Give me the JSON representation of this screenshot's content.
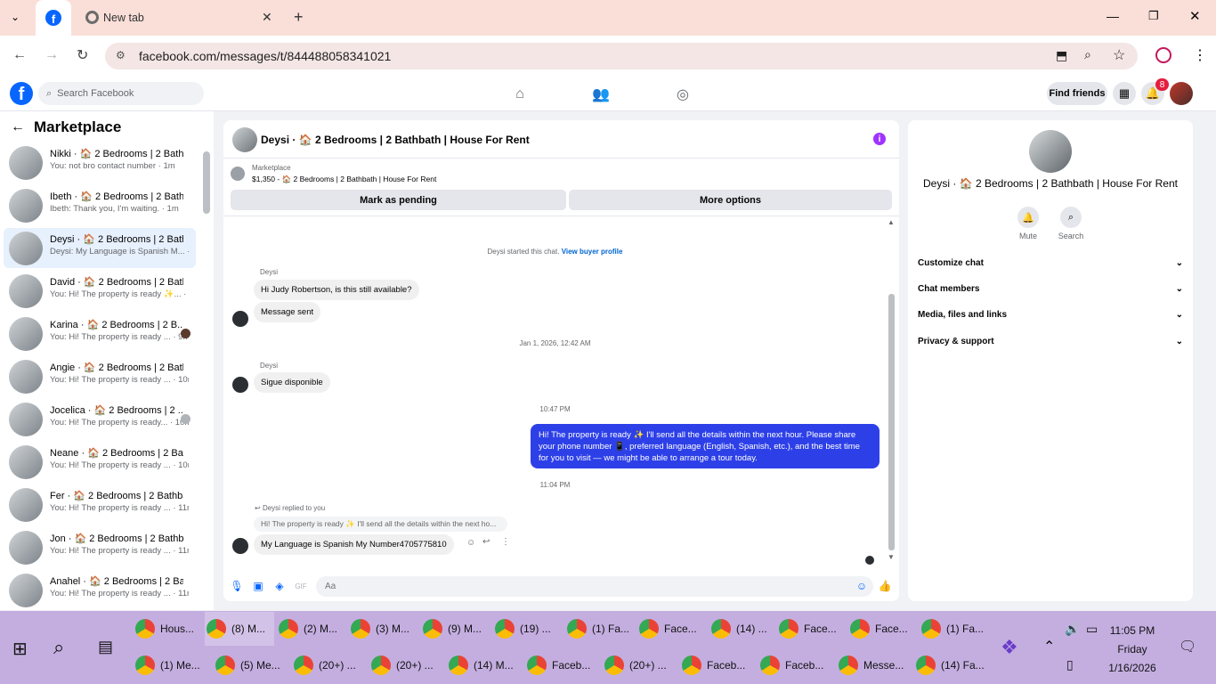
{
  "browser": {
    "tab_active_title": "Facebook",
    "tab_new_label": "New tab",
    "url": "facebook.com/messages/t/844488058341021"
  },
  "fb": {
    "search_placeholder": "Search Facebook",
    "find_friends": "Find friends",
    "notification_count": "8"
  },
  "sidebar": {
    "title": "Marketplace",
    "conversations": [
      {
        "name": "Nikki · 🏠 2 Bedrooms | 2 Bath...",
        "preview": "You: not bro contact number · 1m"
      },
      {
        "name": "Ibeth · 🏠 2 Bedrooms | 2 Bath...",
        "preview": "Ibeth: Thank you, I'm waiting. · 1m"
      },
      {
        "name": "Deysi · 🏠 2 Bedrooms | 2 Bath...",
        "preview": "Deysi: My Language is Spanish M... · 1m"
      },
      {
        "name": "David · 🏠 2 Bedrooms | 2 Bath...",
        "preview": "You: Hi! The property is ready ✨... · 9m"
      },
      {
        "name": "Karina · 🏠 2 Bedrooms | 2 B...",
        "preview": "You: Hi! The property is ready ... · 9m"
      },
      {
        "name": "Angie · 🏠 2 Bedrooms | 2 Bath...",
        "preview": "You: Hi! The property is ready ... · 10m"
      },
      {
        "name": "Jocelica · 🏠 2 Bedrooms | 2 ...",
        "preview": "You: Hi! The property is ready... · 10m"
      },
      {
        "name": "Neane · 🏠 2 Bedrooms | 2 Bat...",
        "preview": "You: Hi! The property is ready ... · 10m"
      },
      {
        "name": "Fer · 🏠 2 Bedrooms | 2 Bathba...",
        "preview": "You: Hi! The property is ready ... · 11m"
      },
      {
        "name": "Jon · 🏠 2 Bedrooms | 2 Bathba...",
        "preview": "You: Hi! The property is ready ... · 11m"
      },
      {
        "name": "Anahel · 🏠 2 Bedrooms | 2 Bat...",
        "preview": "You: Hi! The property is ready ... · 11m"
      }
    ]
  },
  "chat": {
    "title": "Deysi · 🏠 2 Bedrooms | 2 Bathbath | House For Rent",
    "marketplace_label": "Marketplace",
    "listing": "$1,350 - 🏠 2 Bedrooms | 2 Bathbath | House For Rent",
    "mark_pending": "Mark as pending",
    "more_options": "More options",
    "started_text": "Deysi started this chat.",
    "view_profile": "View buyer profile",
    "sender": "Deysi",
    "msg1": "Hi Judy Robertson, is this still available?",
    "msg2": "Message sent",
    "timestamp1": "Jan 1, 2026, 12:42 AM",
    "msg3": "Sigue disponible",
    "timestamp2": "10:47 PM",
    "outgoing": "Hi! The property is ready ✨ I'll send all the details within the next hour. Please share your phone number 📱, preferred language (English, Spanish, etc.), and the best time for you to visit — we might be able to arrange a tour today.",
    "timestamp3": "11:04 PM",
    "reply_label": "Deysi replied to you",
    "quoted": "Hi! The property is ready ✨ I'll send all the details within the next ho...",
    "msg4": "My Language is Spanish My Number4705775810",
    "input_placeholder": "Aa"
  },
  "details": {
    "title": "Deysi · 🏠 2 Bedrooms | 2 Bathbath | House For Rent",
    "mute": "Mute",
    "search": "Search",
    "sections": [
      "Customize chat",
      "Chat members",
      "Media, files and links",
      "Privacy & support"
    ]
  },
  "taskbar": {
    "row1": [
      "Hous...",
      "(8) M...",
      "(2) M...",
      "(3) M...",
      "(9) M...",
      "(19) ...",
      "(1) Fa...",
      "Face...",
      "(14) ...",
      "Face...",
      "Face...",
      "(1) Fa..."
    ],
    "row2": [
      "(1) Me...",
      "(5) Me...",
      "(20+) ...",
      "(20+) ...",
      "(14) M...",
      "Faceb...",
      "(20+) ...",
      "Faceb...",
      "Faceb...",
      "Messe...",
      "(14) Fa..."
    ],
    "time": "11:05 PM",
    "day": "Friday",
    "date": "1/16/2026"
  },
  "colors": {
    "accent": "#0866ff",
    "outgoing_bubble": "#2d40e8",
    "taskbar": "#c4aee0",
    "tabstrip": "#f9dfd8"
  }
}
